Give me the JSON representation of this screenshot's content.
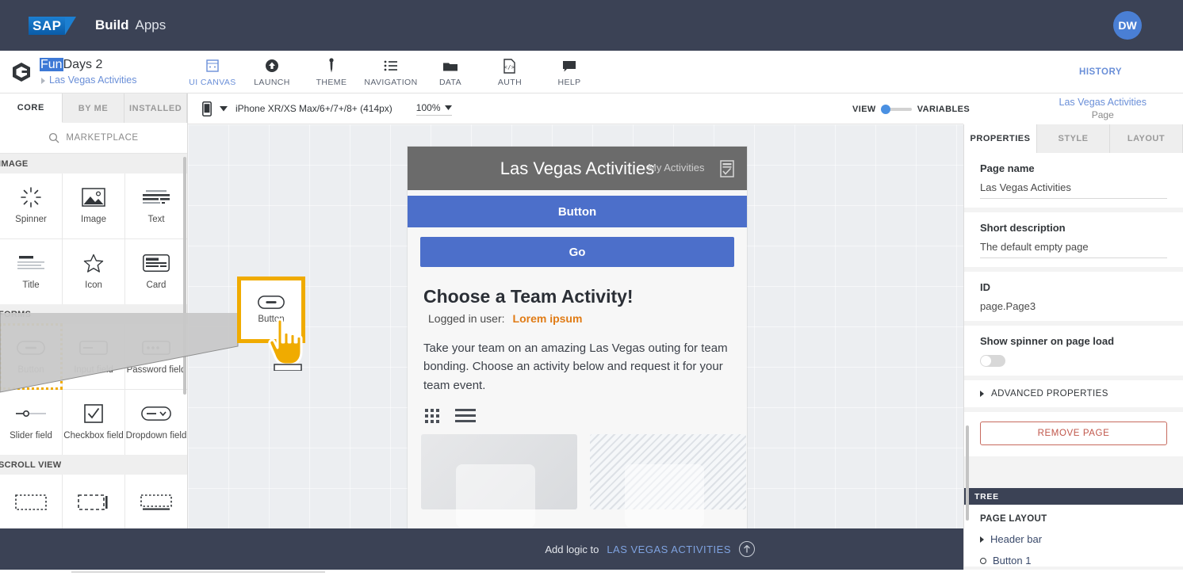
{
  "topbar": {
    "logo_text": "SAP",
    "brand_build": "Build",
    "brand_apps": "Apps",
    "avatar_initials": "DW",
    "accent_color": "#3b4255",
    "avatar_color": "#4a7fd4"
  },
  "subbar": {
    "project_name_highlighted": "Fun",
    "project_name_rest": "Days 2",
    "breadcrumb": "Las Vegas Activities",
    "history_label": "HISTORY",
    "nav": [
      {
        "label": "UI CANVAS",
        "icon": "ui-canvas-icon",
        "active": true
      },
      {
        "label": "LAUNCH",
        "icon": "launch-icon",
        "active": false
      },
      {
        "label": "THEME",
        "icon": "theme-icon",
        "active": false
      },
      {
        "label": "NAVIGATION",
        "icon": "navigation-icon",
        "active": false
      },
      {
        "label": "DATA",
        "icon": "data-icon",
        "active": false
      },
      {
        "label": "AUTH",
        "icon": "auth-icon",
        "active": false
      },
      {
        "label": "HELP",
        "icon": "help-icon",
        "active": false
      }
    ]
  },
  "left_panel": {
    "tabs": [
      {
        "label": "CORE",
        "active": true
      },
      {
        "label": "BY ME",
        "active": false
      },
      {
        "label": "INSTALLED",
        "active": false
      }
    ],
    "search_label": "MARKETPLACE",
    "search_icon": "search-icon",
    "sections": [
      {
        "title": "IMAGE",
        "items": [
          {
            "label": "Spinner",
            "icon": "spinner-icon"
          },
          {
            "label": "Image",
            "icon": "image-icon"
          },
          {
            "label": "Text",
            "icon": "text-icon"
          },
          {
            "label": "Title",
            "icon": "title-icon"
          },
          {
            "label": "Icon",
            "icon": "star-icon"
          },
          {
            "label": "Card",
            "icon": "card-icon"
          }
        ]
      },
      {
        "title": "FORMS",
        "items": [
          {
            "label": "Button",
            "icon": "button-icon",
            "dragging": true
          },
          {
            "label": "Input field",
            "icon": "input-field-icon"
          },
          {
            "label": "Password field",
            "icon": "password-field-icon"
          },
          {
            "label": "Slider field",
            "icon": "slider-field-icon"
          },
          {
            "label": "Checkbox field",
            "icon": "checkbox-field-icon"
          },
          {
            "label": "Dropdown field",
            "icon": "dropdown-field-icon"
          }
        ]
      },
      {
        "title": "SCROLL VIEW",
        "items": [
          {
            "label": "",
            "icon": "scroll-view-icon"
          },
          {
            "label": "",
            "icon": "scroll-view-vertical-icon"
          },
          {
            "label": "",
            "icon": "scroll-view-horizontal-icon"
          }
        ]
      }
    ]
  },
  "drag_ghost": {
    "label": "Button",
    "icon": "button-icon",
    "cursor_icon": "pointing-hand-cursor",
    "border_color": "#f0ab00"
  },
  "canvas_toolbar": {
    "device_icon": "phone-icon",
    "device": "iPhone XR/XS Max/6+/7+/8+ (414px)",
    "zoom": "100%",
    "view_label": "VIEW",
    "variables_label": "VARIABLES",
    "page_title": "Las Vegas Activities",
    "page_subtitle": "Page"
  },
  "phone_preview": {
    "header_title": "Las Vegas Activities",
    "header_secondary": "My Activities",
    "header_icon": "checklist-icon",
    "button_label": "Button",
    "go_label": "Go",
    "heading": "Choose a Team Activity!",
    "logged_in_label": "Logged in user:",
    "logged_in_value": "Lorem ipsum",
    "paragraph": "Take your team on an amazing Las Vegas outing for team bonding. Choose an activity below and request it for your team event.",
    "grid_icon": "grid-view-icon",
    "list_icon": "list-view-icon",
    "accent_button_color": "#4c6fca",
    "accent_user_color": "#e07b15"
  },
  "right_panel": {
    "tabs": [
      {
        "label": "PROPERTIES",
        "active": true
      },
      {
        "label": "STYLE",
        "active": false
      },
      {
        "label": "LAYOUT",
        "active": false
      }
    ],
    "page_name_label": "Page name",
    "page_name_value": "Las Vegas Activities",
    "short_description_label": "Short description",
    "short_description_value": "The default empty page",
    "id_label": "ID",
    "id_value": "page.Page3",
    "spinner_label": "Show spinner on page load",
    "spinner_on": false,
    "advanced_label": "ADVANCED PROPERTIES",
    "remove_label": "REMOVE PAGE",
    "remove_color": "#c0564a",
    "tree_header": "TREE",
    "tree_root": "PAGE LAYOUT",
    "tree_items": [
      {
        "label": "Header bar",
        "type": "expandable"
      },
      {
        "label": "Button 1",
        "type": "leaf"
      }
    ]
  },
  "bottom_bar": {
    "prefix": "Add logic to",
    "target": "LAS VEGAS ACTIVITIES",
    "icon": "arrow-up-circle-icon"
  }
}
